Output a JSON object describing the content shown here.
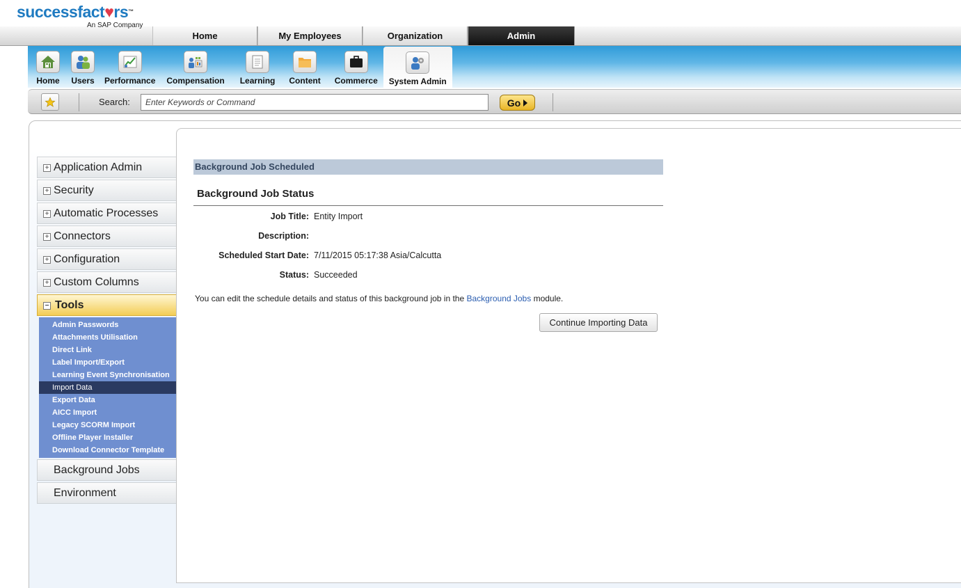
{
  "brand": {
    "word_a": "success",
    "word_b": "fact",
    "heart": "♥",
    "word_c": "rs",
    "tm": "™",
    "sub": "An SAP Company",
    "color": "#1f7bc1"
  },
  "main_tabs": [
    "Home",
    "My Employees",
    "Organization",
    "Admin"
  ],
  "active_tab": "Admin",
  "modules": [
    {
      "label": "Home",
      "icon": "house-icon"
    },
    {
      "label": "Users",
      "icon": "users-icon"
    },
    {
      "label": "Performance",
      "icon": "performance-chart-icon"
    },
    {
      "label": "Compensation",
      "icon": "compensation-icon"
    },
    {
      "label": "Learning",
      "icon": "document-icon"
    },
    {
      "label": "Content",
      "icon": "folder-icon"
    },
    {
      "label": "Commerce",
      "icon": "briefcase-icon"
    },
    {
      "label": "System Admin",
      "icon": "system-admin-icon"
    }
  ],
  "active_module": "System Admin",
  "search": {
    "label": "Search:",
    "placeholder": "Enter Keywords or Command",
    "go_label": "Go"
  },
  "leftnav": {
    "sections_before": [
      "Application Admin",
      "Security",
      "Automatic Processes",
      "Connectors",
      "Configuration",
      "Custom Columns"
    ],
    "active_section": "Tools",
    "tools_items": [
      "Admin Passwords",
      "Attachments Utilisation",
      "Direct Link",
      "Label Import/Export",
      "Learning Event Synchronisation",
      "Import Data",
      "Export Data",
      "AICC Import",
      "Legacy SCORM Import",
      "Offline Player Installer",
      "Download Connector Template"
    ],
    "active_tool": "Import Data",
    "sections_after": [
      "Background Jobs",
      "Environment"
    ]
  },
  "content": {
    "header": "Background Job Scheduled",
    "status_title": "Background Job Status",
    "fields": [
      {
        "label": "Job Title:",
        "value": "Entity Import"
      },
      {
        "label": "Description:",
        "value": ""
      },
      {
        "label": "Scheduled Start Date:",
        "value": "7/11/2015 05:17:38 Asia/Calcutta"
      },
      {
        "label": "Status:",
        "value": "Succeeded"
      }
    ],
    "note_before": "You can edit the schedule details and status of this background job in the ",
    "note_link": "Background Jobs",
    "note_after": " module.",
    "continue_label": "Continue Importing Data"
  }
}
